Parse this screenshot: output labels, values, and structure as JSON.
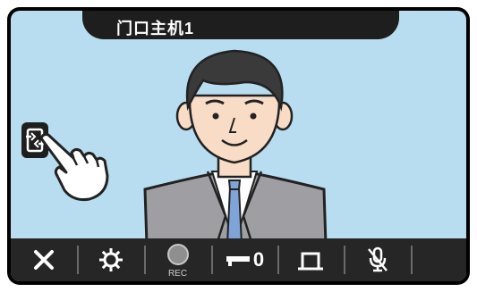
{
  "header": {
    "title": "门口主机1"
  },
  "video": {
    "subject": "visitor"
  },
  "side_controls": {
    "switch_icon": "camera-switch-icon"
  },
  "toolbar": {
    "buttons": [
      {
        "name": "end-call-button",
        "icon": "close-icon"
      },
      {
        "name": "settings-button",
        "icon": "gear-icon"
      },
      {
        "name": "record-button",
        "icon": "record-icon",
        "label": "REC"
      },
      {
        "name": "unlock-button",
        "icon": "key-icon",
        "label": "0"
      },
      {
        "name": "option-button",
        "icon": "output-icon"
      },
      {
        "name": "mute-button",
        "icon": "mic-mute-icon"
      }
    ]
  },
  "colors": {
    "background": "#b9ddf0",
    "toolbar": "#262626",
    "title_tab": "#1e1e1e"
  }
}
